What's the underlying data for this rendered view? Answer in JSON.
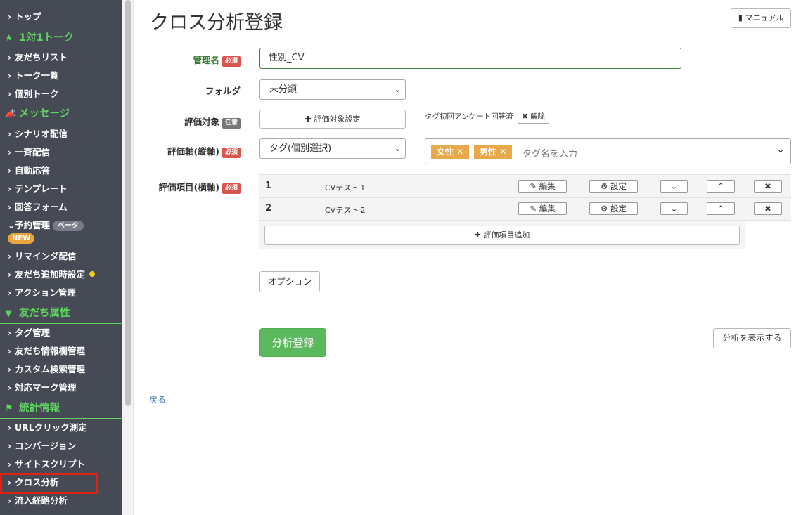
{
  "sidebar": {
    "top": "トップ",
    "section_talk": "1対1トーク",
    "friends_list": "友だちリスト",
    "talk_list": "トーク一覧",
    "individual_talk": "個別トーク",
    "section_message": "メッセージ",
    "scenario": "シナリオ配信",
    "broadcast": "一斉配信",
    "auto_reply": "自動応答",
    "template": "テンプレート",
    "answer_form": "回答フォーム",
    "reservation": "予約管理",
    "beta": "ベータ",
    "new": "NEW",
    "reminder": "リマインダ配信",
    "friend_add_setting": "友だち追加時設定",
    "action_manage": "アクション管理",
    "section_attr": "友だち属性",
    "tag_manage": "タグ管理",
    "friend_info": "友だち情報欄管理",
    "custom_search": "カスタム検索管理",
    "mark_manage": "対応マーク管理",
    "section_stats": "統計情報",
    "url_click": "URLクリック測定",
    "conversion": "コンバージョン",
    "site_script": "サイトスクリプト",
    "cross_analysis": "クロス分析",
    "inflow_analysis": "流入経路分析"
  },
  "header": {
    "title": "クロス分析登録",
    "manual_label": "マニュアル"
  },
  "form": {
    "name_label": "管理名",
    "required": "必須",
    "optional": "任意",
    "name_value": "性別_CV",
    "folder_label": "フォルダ",
    "folder_value": "未分類",
    "target_label": "評価対象",
    "target_button": "評価対象設定",
    "target_note": "タグ初回アンケート回答済",
    "release_label": "解除",
    "axis_label": "評価軸(縦軸)",
    "axis_value": "タグ(個別選択)",
    "tags": [
      "女性",
      "男性"
    ],
    "tag_placeholder": "タグ名を入力",
    "items_label": "評価項目(横軸)",
    "items": [
      {
        "num": "1",
        "name": "CVテスト１"
      },
      {
        "num": "2",
        "name": "CVテスト２"
      }
    ],
    "edit_label": "編集",
    "setting_label": "設定",
    "add_item_label": "評価項目追加",
    "options_label": "オプション",
    "submit_label": "分析登録",
    "show_analysis_label": "分析を表示する",
    "back_label": "戻る"
  },
  "colors": {
    "sidebar_bg": "#454a55",
    "sidebar_heading": "#5fd35f",
    "required_badge": "#d9534f",
    "tag_chip": "#e8a94b",
    "submit_button": "#5cb85c",
    "link": "#3a78b5",
    "highlight": "#e02210"
  }
}
